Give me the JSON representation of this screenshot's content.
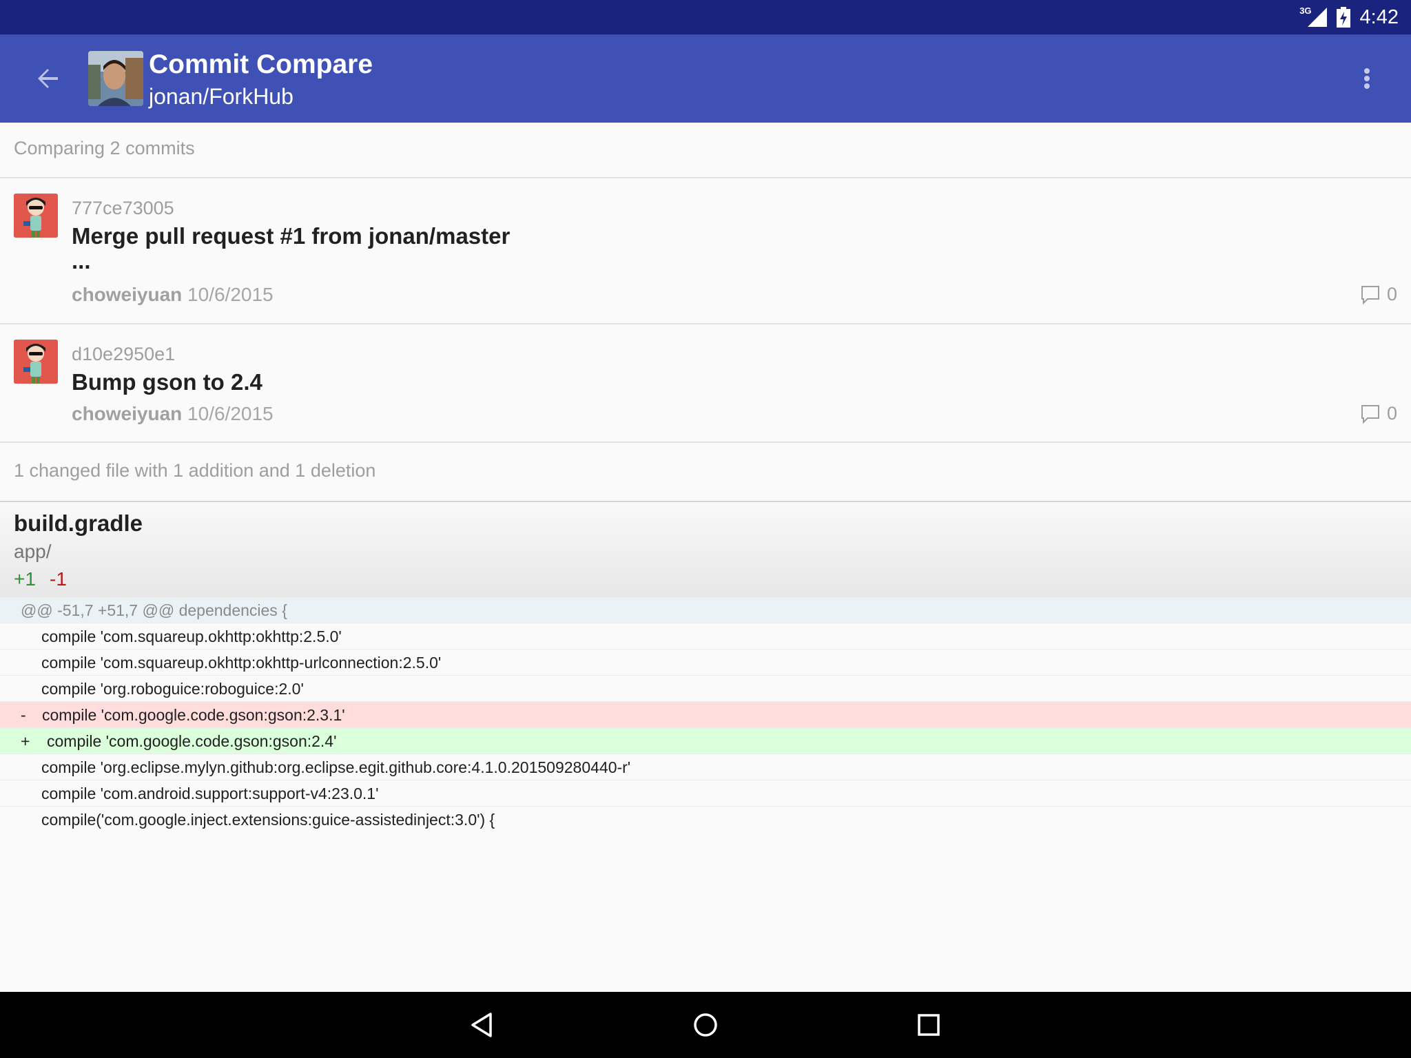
{
  "status_bar": {
    "network_type": "3G",
    "time": "4:42"
  },
  "app_bar": {
    "title": "Commit Compare",
    "subtitle": "jonan/ForkHub"
  },
  "commits_header": "Comparing 2 commits",
  "commits": [
    {
      "sha": "777ce73005",
      "message_line1": "Merge pull request #1 from jonan/master",
      "message_line2": "...",
      "author": "choweiyuan",
      "date": "10/6/2015",
      "comment_count": "0"
    },
    {
      "sha": "d10e2950e1",
      "message_line1": "Bump gson to 2.4",
      "author": "choweiyuan",
      "date": "10/6/2015",
      "comment_count": "0"
    }
  ],
  "files_summary": "1 changed file with 1 addition  and 1 deletion",
  "file": {
    "name": "build.gradle",
    "path": "app/",
    "additions": "+1",
    "deletions": "-1"
  },
  "diff": {
    "hunk_header": "@@ -51,7 +51,7 @@ dependencies {",
    "lines": [
      {
        "type": "context",
        "marker": "",
        "code": "compile 'com.squareup.okhttp:okhttp:2.5.0'"
      },
      {
        "type": "context",
        "marker": "",
        "code": "compile 'com.squareup.okhttp:okhttp-urlconnection:2.5.0'"
      },
      {
        "type": "context",
        "marker": "",
        "code": "compile 'org.roboguice:roboguice:2.0'"
      },
      {
        "type": "removed",
        "marker": "-",
        "code": "compile 'com.google.code.gson:gson:2.3.1'"
      },
      {
        "type": "added",
        "marker": "+",
        "code": "compile 'com.google.code.gson:gson:2.4'"
      },
      {
        "type": "context",
        "marker": "",
        "code": "compile 'org.eclipse.mylyn.github:org.eclipse.egit.github.core:4.1.0.201509280440-r'"
      },
      {
        "type": "context",
        "marker": "",
        "code": "compile 'com.android.support:support-v4:23.0.1'"
      },
      {
        "type": "context",
        "marker": "",
        "code": "compile('com.google.inject.extensions:guice-assistedinject:3.0') {"
      }
    ]
  },
  "colors": {
    "status_bar": "#1a237e",
    "app_bar": "#3f51b5",
    "diff_added_bg": "#dbffdb",
    "diff_removed_bg": "#ffdddd",
    "diff_hunk_bg": "#eaf2f6",
    "additions_text": "#388e3c",
    "deletions_text": "#b71c1c"
  },
  "icons": {
    "back": "arrow-back-icon",
    "overflow": "more-vert-icon",
    "comment": "comment-icon",
    "nav_back": "triangle-back-icon",
    "nav_home": "circle-home-icon",
    "nav_recents": "square-recents-icon"
  }
}
